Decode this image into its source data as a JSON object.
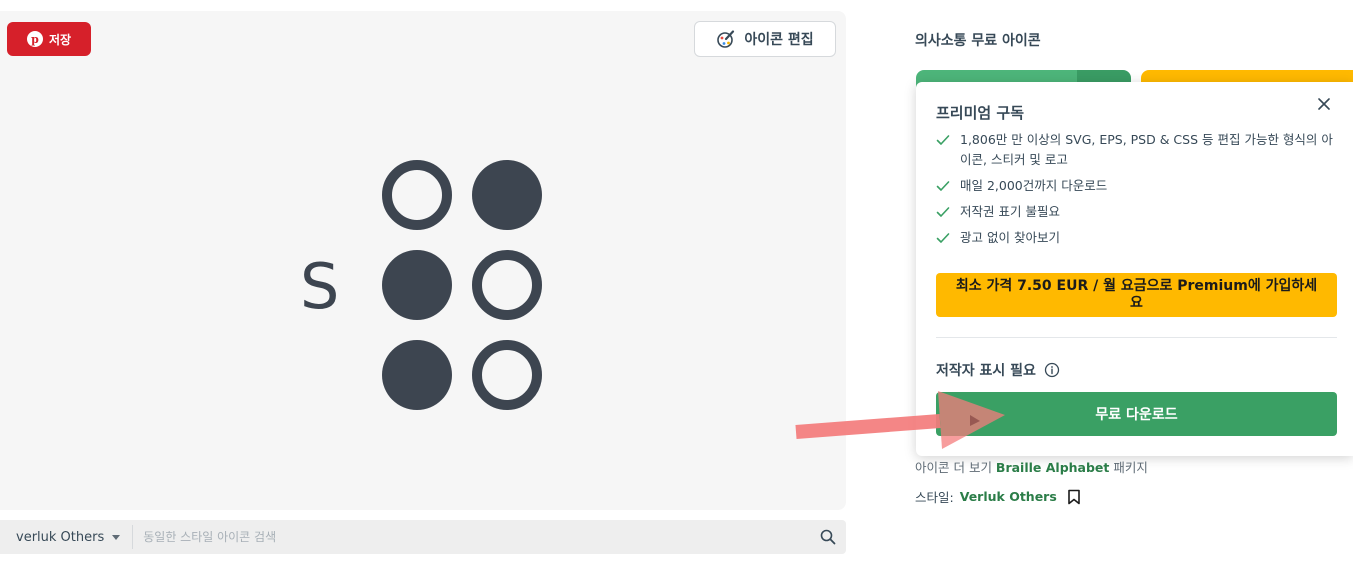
{
  "preview": {
    "save_label": "저장",
    "pin_glyph": "p",
    "edit_label": "아이콘 편집",
    "braille_letter": "S",
    "braille_dots": [
      false,
      true,
      true,
      false,
      true,
      false
    ],
    "dot_color": "#3d4550"
  },
  "search": {
    "author": "verluk Others",
    "placeholder": "동일한 스타일 아이콘 검색"
  },
  "sidebar": {
    "title": "의사소통 무료 아이콘",
    "popup": {
      "title": "프리미엄 구독",
      "features": [
        "1,806만 만 이상의 SVG, EPS, PSD & CSS 등 편집 가능한 형식의 아이콘, 스티커 및 로고",
        "매일 2,000건까지 다운로드",
        "저작권 표기 불필요",
        "광고 없이 찾아보기"
      ],
      "premium_cta": "최소 가격 7.50 EUR / 월 요금으로 Premium에 가입하세요",
      "attribution_label": "저작자 표시 필요",
      "download_label": "무료 다운로드"
    },
    "more_icons": {
      "prefix": "아이콘 더 보기 ",
      "pack_name": "Braille Alphabet",
      "suffix": " 패키지"
    },
    "style": {
      "label": "스타일:",
      "value": "Verluk Others"
    }
  },
  "colors": {
    "brand_green": "#3aa064",
    "premium_yellow": "#ffb900",
    "pinterest_red": "#d6202a",
    "arrow_red": "#f47c7c"
  }
}
